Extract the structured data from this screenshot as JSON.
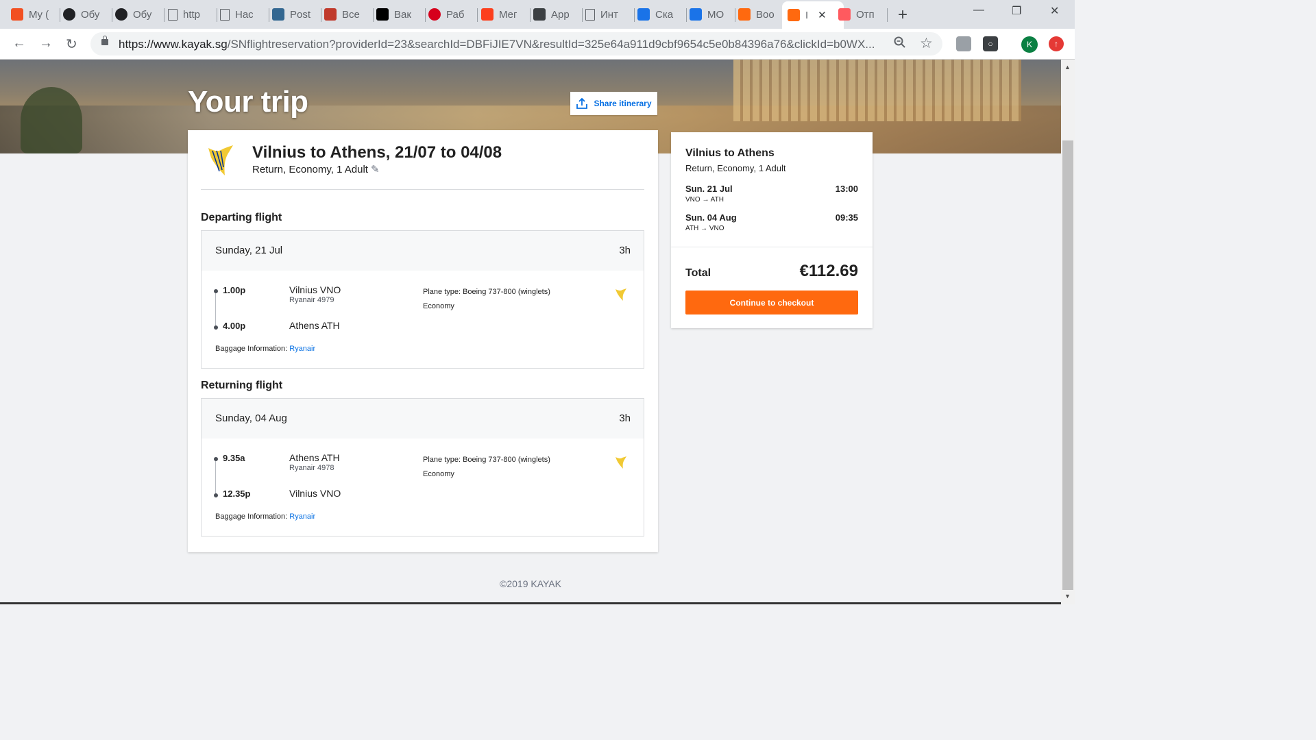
{
  "browser": {
    "tabs": [
      {
        "label": "My (",
        "icon": "microsoft-icon",
        "color": "#f25022"
      },
      {
        "label": "Обу",
        "icon": "openai-icon",
        "color": "#202124"
      },
      {
        "label": "Обу",
        "icon": "openai-icon",
        "color": "#202124"
      },
      {
        "label": "http",
        "icon": "page-icon",
        "color": "#5f6368"
      },
      {
        "label": "Нас",
        "icon": "page-icon",
        "color": "#5f6368"
      },
      {
        "label": "Post",
        "icon": "postgres-icon",
        "color": "#336791"
      },
      {
        "label": "Все",
        "icon": "sheet-icon",
        "color": "#c0392b"
      },
      {
        "label": "Вак",
        "icon": "m-icon",
        "color": "#000000"
      },
      {
        "label": "Раб",
        "icon": "hh-icon",
        "color": "#d6001c"
      },
      {
        "label": "Мег",
        "icon": "yandex-icon",
        "color": "#fc3f1d"
      },
      {
        "label": "App",
        "icon": "pin-icon",
        "color": "#3c4043"
      },
      {
        "label": "Инт",
        "icon": "page-icon",
        "color": "#5f6368"
      },
      {
        "label": "Ска",
        "icon": "download-icon",
        "color": "#1a73e8"
      },
      {
        "label": "МО",
        "icon": "arc-icon",
        "color": "#1a73e8"
      },
      {
        "label": "Boo",
        "icon": "kayak-icon",
        "color": "#ff690f"
      },
      {
        "label": "I",
        "icon": "kayak-icon",
        "color": "#ff690f",
        "active": true
      },
      {
        "label": "Отп",
        "icon": "airbnb-icon",
        "color": "#ff5a5f"
      }
    ],
    "url_host": "https://www.kayak.sg",
    "url_path": "/SNflightreservation?providerId=23&searchId=DBFiJIE7VN&resultId=325e64a911d9cbf9654c5e0b84396a76&clickId=b0WX...",
    "profile_initial": "K"
  },
  "page": {
    "title": "Your trip",
    "share_label": "Share itinerary",
    "trip_title": "Vilnius to Athens, 21/07 to 04/08",
    "trip_sub": "Return, Economy, 1 Adult",
    "departing": {
      "section_title": "Departing flight",
      "date": "Sunday, 21 Jul",
      "duration": "3h",
      "dep_time": "1.00p",
      "dep_place": "Vilnius VNO",
      "flight_no": "Ryanair 4979",
      "arr_time": "4.00p",
      "arr_place": "Athens ATH",
      "plane": "Plane type: Boeing 737-800 (winglets)",
      "cabin": "Economy",
      "baggage_label": "Baggage Information:",
      "baggage_link": "Ryanair"
    },
    "returning": {
      "section_title": "Returning flight",
      "date": "Sunday, 04 Aug",
      "duration": "3h",
      "dep_time": "9.35a",
      "dep_place": "Athens ATH",
      "flight_no": "Ryanair 4978",
      "arr_time": "12.35p",
      "arr_place": "Vilnius VNO",
      "plane": "Plane type: Boeing 737-800 (winglets)",
      "cabin": "Economy",
      "baggage_label": "Baggage Information:",
      "baggage_link": "Ryanair"
    },
    "summary": {
      "title": "Vilnius to Athens",
      "sub": "Return, Economy, 1 Adult",
      "leg1_date": "Sun. 21 Jul",
      "leg1_route": "VNO → ATH",
      "leg1_time": "13:00",
      "leg2_date": "Sun. 04 Aug",
      "leg2_route": "ATH → VNO",
      "leg2_time": "09:35",
      "total_label": "Total",
      "total_value": "€112.69",
      "checkout_label": "Continue to checkout"
    },
    "footer": "©2019 KAYAK"
  },
  "colors": {
    "accent_orange": "#ff690f",
    "link_blue": "#0770e3",
    "ryanair_gold": "#f1c933"
  }
}
